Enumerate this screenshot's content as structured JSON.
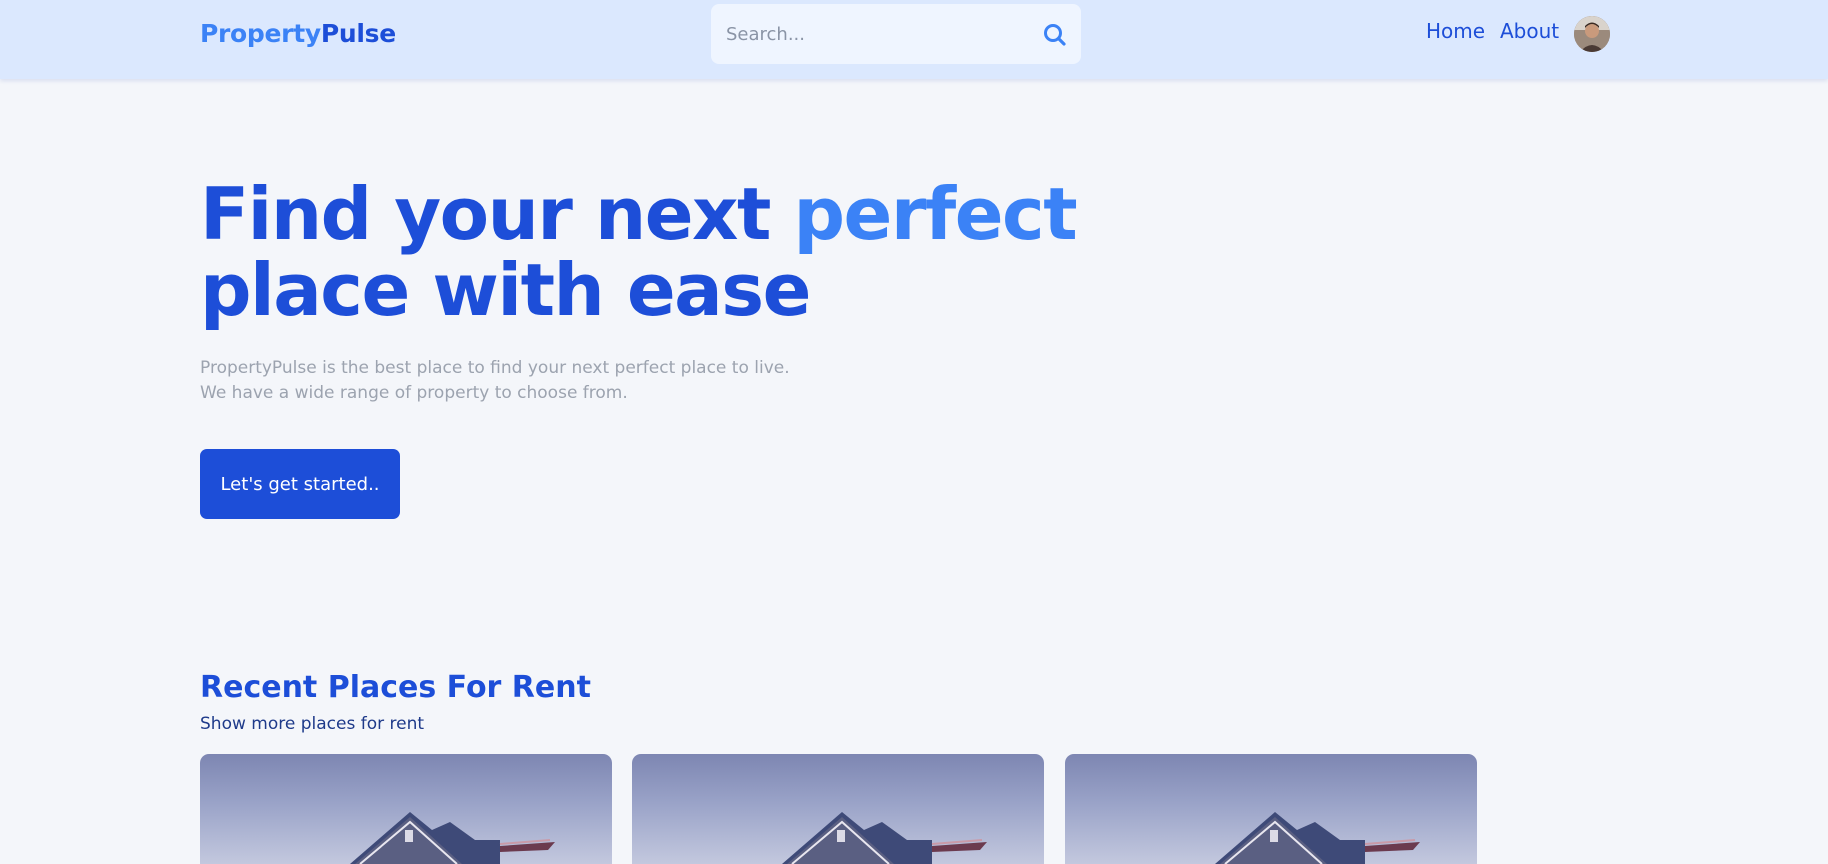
{
  "header": {
    "brand_part1": "Property",
    "brand_part2": "Pulse",
    "search": {
      "placeholder": "Search...",
      "icon": "search-icon"
    },
    "nav": [
      {
        "label": "Home"
      },
      {
        "label": "About"
      }
    ],
    "avatar_icon": "user-avatar"
  },
  "hero": {
    "title_line1": "Find your next ",
    "title_accent": "perfect",
    "title_line2": "place with ease",
    "desc_line1": "PropertyPulse is the best place to find your next perfect place to live.",
    "desc_line2": "We have a wide range of property to choose from.",
    "cta_label": "Let's get started.."
  },
  "recent": {
    "title": "Recent Places For Rent",
    "more_link": "Show more places for rent",
    "cards": [
      {
        "image": "house-photo"
      },
      {
        "image": "house-photo"
      },
      {
        "image": "house-photo"
      }
    ]
  },
  "colors": {
    "header_bg": "#dbe8fe",
    "primary": "#1d4ed8",
    "accent": "#3b82f6",
    "page_bg": "#f4f6fa",
    "muted_text": "#9ca3af"
  }
}
